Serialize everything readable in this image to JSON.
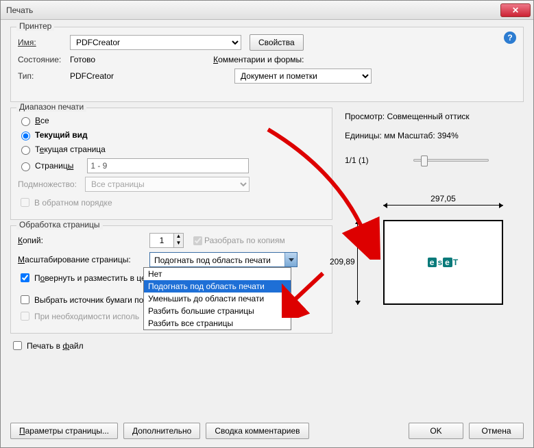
{
  "title": "Печать",
  "printer_group": {
    "legend": "Принтер",
    "name_label": "Имя:",
    "name_value": "PDFCreator",
    "properties_btn": "Свойства",
    "state_label": "Состояние:",
    "state_value": "Готово",
    "type_label": "Тип:",
    "type_value": "PDFCreator",
    "comments_label": "Комментарии и формы:",
    "comments_value": "Документ и пометки"
  },
  "range_group": {
    "legend": "Диапазон печати",
    "all": "Все",
    "current_view": "Текущий вид",
    "current_page": "Текущая страница",
    "pages": "Страницы",
    "pages_value": "1 - 9",
    "subset_label": "Подмножество:",
    "subset_value": "Все страницы",
    "reverse": "В обратном порядке"
  },
  "handling_group": {
    "legend": "Обработка страницы",
    "copies_label": "Копий:",
    "copies_value": "1",
    "collate": "Разобрать по копиям",
    "scaling_label": "Масштабирование страницы:",
    "scaling_value": "Подогнать под область печати",
    "scaling_options": [
      "Нет",
      "Подогнать под область печати",
      "Уменьшить до области печати",
      "Разбить большие страницы",
      "Разбить все страницы"
    ],
    "rotate": "Повернуть и разместить в центре",
    "paper_source": "Выбрать источник бумаги по размеру страницы PDF",
    "use_custom": "При необходимости использовать пользовательский размер бумаги"
  },
  "print_to_file": "Печать в файл",
  "preview": {
    "title": "Просмотр: Совмещенный оттиск",
    "units": "Единицы: мм Масштаб: 394%",
    "page_of": "1/1 (1)",
    "width": "297,05",
    "height": "209,89",
    "logo_text": "eset"
  },
  "footer": {
    "page_setup": "Параметры страницы...",
    "advanced": "Дополнительно",
    "comments_summary": "Сводка комментариев",
    "ok": "OK",
    "cancel": "Отмена"
  }
}
